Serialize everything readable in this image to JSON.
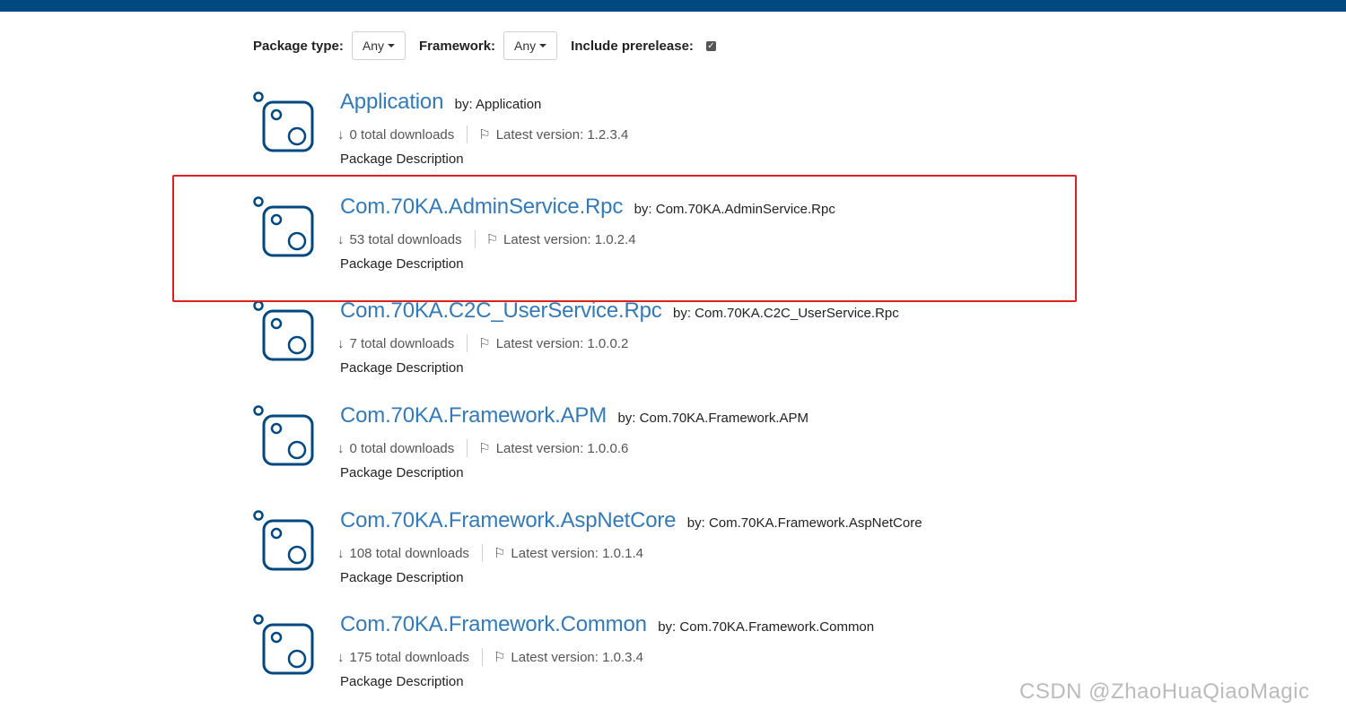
{
  "filters": {
    "package_type_label": "Package type:",
    "package_type_value": "Any",
    "framework_label": "Framework:",
    "framework_value": "Any",
    "prerelease_label": "Include prerelease:",
    "prerelease_checked": true
  },
  "packages": [
    {
      "title": "Application",
      "by": "by: Application",
      "downloads": "0 total downloads",
      "version": "Latest version: 1.2.3.4",
      "description": "Package Description"
    },
    {
      "title": "Com.70KA.AdminService.Rpc",
      "by": "by: Com.70KA.AdminService.Rpc",
      "downloads": "53 total downloads",
      "version": "Latest version: 1.0.2.4",
      "description": "Package Description",
      "highlighted": true
    },
    {
      "title": "Com.70KA.C2C_UserService.Rpc",
      "by": "by: Com.70KA.C2C_UserService.Rpc",
      "downloads": "7 total downloads",
      "version": "Latest version: 1.0.0.2",
      "description": "Package Description"
    },
    {
      "title": "Com.70KA.Framework.APM",
      "by": "by: Com.70KA.Framework.APM",
      "downloads": "0 total downloads",
      "version": "Latest version: 1.0.0.6",
      "description": "Package Description"
    },
    {
      "title": "Com.70KA.Framework.AspNetCore",
      "by": "by: Com.70KA.Framework.AspNetCore",
      "downloads": "108 total downloads",
      "version": "Latest version: 1.0.1.4",
      "description": "Package Description"
    },
    {
      "title": "Com.70KA.Framework.Common",
      "by": "by: Com.70KA.Framework.Common",
      "downloads": "175 total downloads",
      "version": "Latest version: 1.0.3.4",
      "description": "Package Description"
    }
  ],
  "icons": {
    "package": "package-default-icon",
    "download": "download-icon",
    "flag": "flag-icon"
  },
  "colors": {
    "topbar": "#004880",
    "link": "#337ab7",
    "icon": "#004880",
    "highlight": "#e02020"
  },
  "watermark": "CSDN @ZhaoHuaQiaoMagic"
}
